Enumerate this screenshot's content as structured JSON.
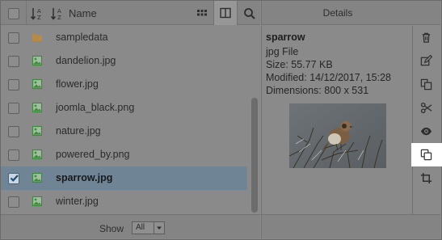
{
  "toolbar": {
    "name_label": "Name"
  },
  "details_header": {
    "title": "Details"
  },
  "files": [
    {
      "name": "sampledata",
      "type": "folder",
      "selected": false
    },
    {
      "name": "dandelion.jpg",
      "type": "image",
      "selected": false
    },
    {
      "name": "flower.jpg",
      "type": "image",
      "selected": false
    },
    {
      "name": "joomla_black.png",
      "type": "image",
      "selected": false
    },
    {
      "name": "nature.jpg",
      "type": "image",
      "selected": false
    },
    {
      "name": "powered_by.png",
      "type": "image",
      "selected": false
    },
    {
      "name": "sparrow.jpg",
      "type": "image",
      "selected": true
    },
    {
      "name": "winter.jpg",
      "type": "image",
      "selected": false
    }
  ],
  "footer": {
    "show_label": "Show",
    "show_value": "All"
  },
  "details": {
    "name": "sparrow",
    "file_type": "jpg File",
    "size": "Size: 55.77 KB",
    "modified": "Modified: 14/12/2017, 15:28",
    "dimensions": "Dimensions: 800 x 531"
  },
  "actions": [
    {
      "name": "delete",
      "icon": "trash-icon"
    },
    {
      "name": "edit",
      "icon": "edit-icon"
    },
    {
      "name": "copy",
      "icon": "copy-icon"
    },
    {
      "name": "cut",
      "icon": "scissors-icon"
    },
    {
      "name": "preview",
      "icon": "eye-icon"
    },
    {
      "name": "duplicate",
      "icon": "duplicate-icon"
    },
    {
      "name": "crop",
      "icon": "crop-icon"
    }
  ],
  "colors": {
    "selected_row": "#6f8596",
    "folder": "#b58a4a",
    "image_icon": "#3f8a3f",
    "highlight": "#ffffff"
  }
}
